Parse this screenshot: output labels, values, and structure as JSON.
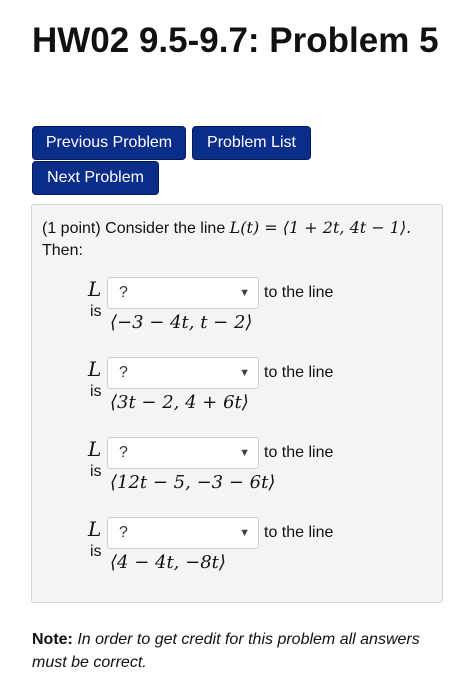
{
  "page_title": "HW02 9.5-9.7: Problem 5",
  "nav": {
    "previous_label": "Previous Problem",
    "list_label": "Problem List",
    "next_label": "Next Problem"
  },
  "problem": {
    "points": "(1 point) Consider the line",
    "line_def": "L(t) = ⟨1 + 2t, 4t − 1⟩.",
    "then": "Then:",
    "rows": [
      {
        "L": "L",
        "is": "is",
        "select_value": "?",
        "tail": "to the line",
        "vector": "⟨−3 − 4t, t − 2⟩"
      },
      {
        "L": "L",
        "is": "is",
        "select_value": "?",
        "tail": "to the line",
        "vector": "⟨3t − 2, 4 + 6t⟩"
      },
      {
        "L": "L",
        "is": "is",
        "select_value": "?",
        "tail": "to the line",
        "vector": "⟨12t − 5, −3 − 6t⟩"
      },
      {
        "L": "L",
        "is": "is",
        "select_value": "?",
        "tail": "to the line",
        "vector": "⟨4 − 4t, −8t⟩"
      }
    ]
  },
  "note": {
    "label": "Note:",
    "text": "In order to get credit for this problem all answers must be correct."
  },
  "colors": {
    "button_bg": "#0b2d8a",
    "box_bg": "#f5f5f5"
  },
  "icons": {
    "select_arrow": "chevron-down-icon"
  }
}
